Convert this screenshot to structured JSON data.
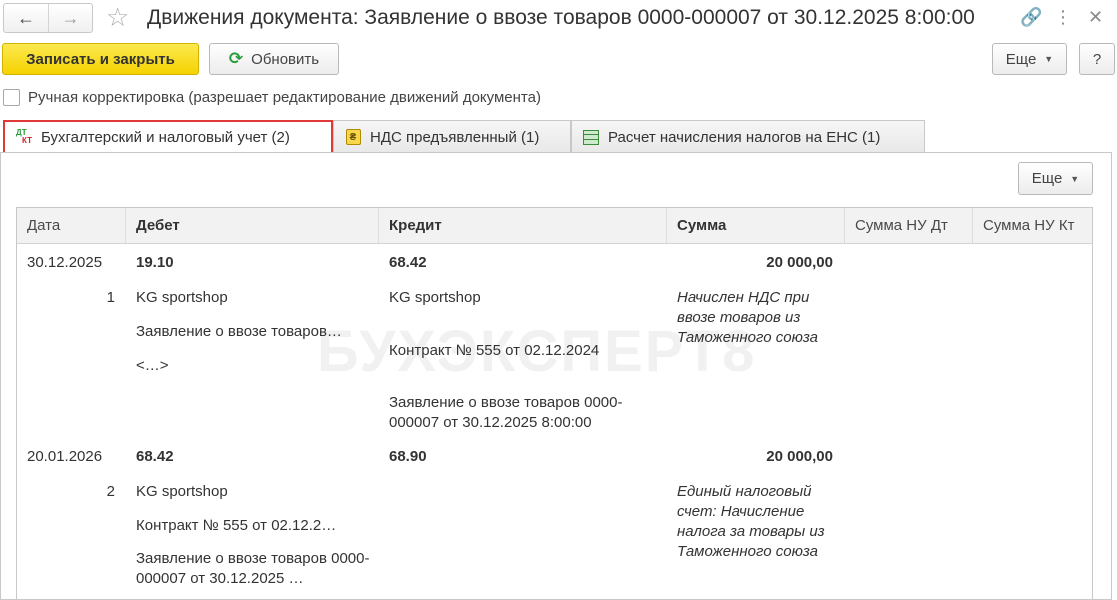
{
  "window": {
    "title": "Движения документа: Заявление о ввозе товаров 0000-000007 от 30.12.2025 8:00:00"
  },
  "toolbar": {
    "save_close_label": "Записать и закрыть",
    "refresh_label": "Обновить",
    "more_label": "Еще",
    "help_label": "?"
  },
  "manual_edit": {
    "label": "Ручная корректировка (разрешает редактирование движений документа)"
  },
  "tabs": [
    {
      "label": "Бухгалтерский и налоговый учет (2)",
      "icon": "dt-kt-icon"
    },
    {
      "label": "НДС предъявленный (1)",
      "icon": "register-icon"
    },
    {
      "label": "Расчет начисления налогов на ЕНС (1)",
      "icon": "table-icon"
    }
  ],
  "panel": {
    "more_label": "Еще"
  },
  "watermark": "БУХЭКСПЕРТ8",
  "table": {
    "columns": [
      "Дата",
      "Дебет",
      "Кредит",
      "Сумма",
      "Сумма НУ Дт",
      "Сумма НУ Кт"
    ],
    "rows": [
      {
        "date": "30.12.2025",
        "number": "1",
        "debit_account": "19.10",
        "debit_sub1": "KG sportshop",
        "debit_sub2": "Заявление о ввозе товаров…",
        "debit_sub3": "<…>",
        "credit_account": "68.42",
        "credit_sub1": "KG sportshop",
        "credit_sub2": "Контракт № 555 от 02.12.2024",
        "credit_sub3": "Заявление о ввозе товаров 0000-000007 от 30.12.2025 8:00:00",
        "amount": "20 000,00",
        "content": "Начислен НДС при ввозе товаров из Таможенного союза"
      },
      {
        "date": "20.01.2026",
        "number": "2",
        "debit_account": "68.42",
        "debit_sub1": "KG sportshop",
        "debit_sub2": "Контракт № 555 от 02.12.2…",
        "debit_sub3": "Заявление о ввозе товаров 0000-000007 от 30.12.2025 …",
        "credit_account": "68.90",
        "amount": "20 000,00",
        "content": "Единый налоговый счет: Начисление налога за товары из Таможенного союза"
      }
    ]
  }
}
